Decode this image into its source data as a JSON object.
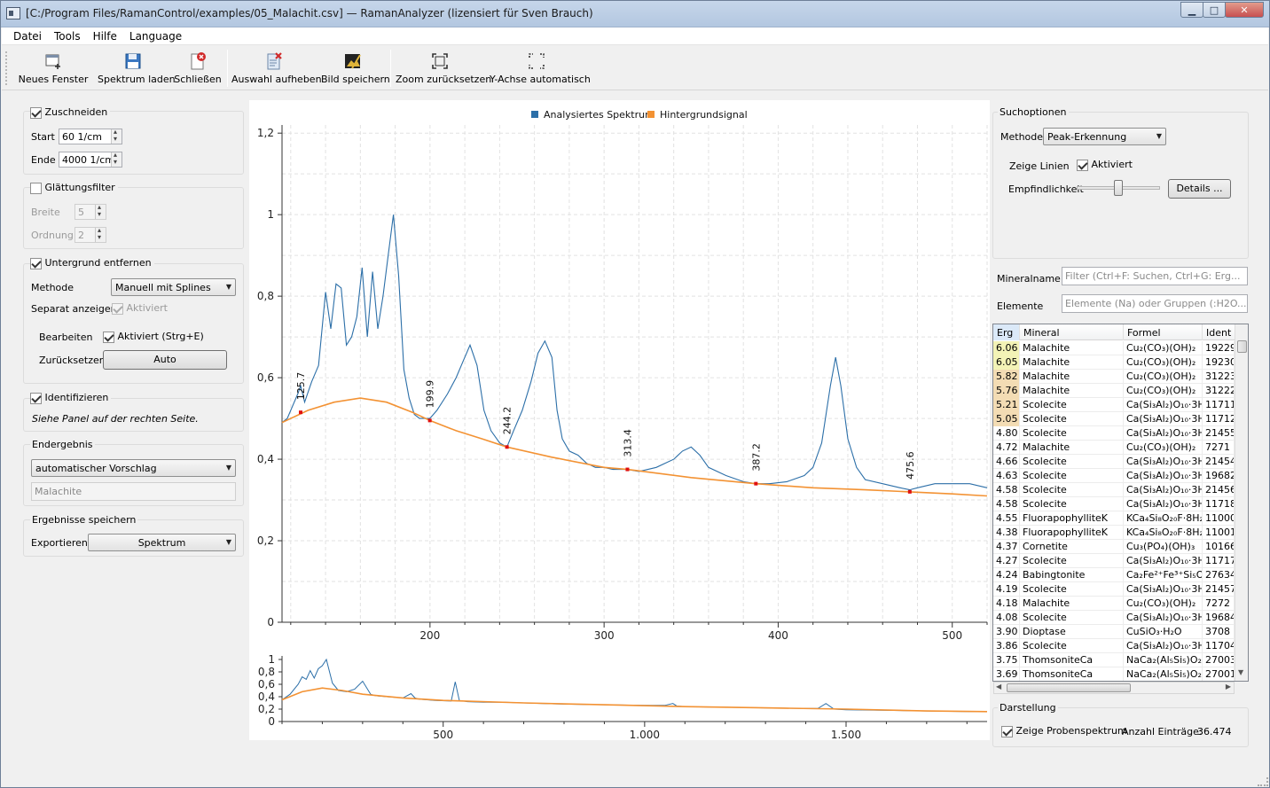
{
  "window": {
    "title": "[C:/Program Files/RamanControl/examples/05_Malachit.csv] — RamanAnalyzer (lizensiert für Sven Brauch)",
    "min_glyph": "▁",
    "max_glyph": "□",
    "close_glyph": "✕"
  },
  "menu": [
    "Datei",
    "Tools",
    "Hilfe",
    "Language"
  ],
  "toolbar": {
    "new_window": "Neues Fenster",
    "load_spectrum": "Spektrum laden",
    "close": "Schließen",
    "clear_selection": "Auswahl aufheben",
    "save_image": "Bild speichern",
    "reset_zoom": "Zoom zurücksetzen",
    "y_auto": "Y-Achse automatisch"
  },
  "left": {
    "crop": {
      "label": "Zuschneiden",
      "checked": true,
      "start_label": "Start",
      "start_value": "60 1/cm",
      "end_label": "Ende",
      "end_value": "4000 1/cm"
    },
    "smooth": {
      "label": "Glättungsfilter",
      "checked": false,
      "width_label": "Breite",
      "width_value": "5",
      "order_label": "Ordnung",
      "order_value": "2"
    },
    "background": {
      "label": "Untergrund entfernen",
      "checked": true,
      "method_label": "Methode",
      "method_value": "Manuell mit Splines",
      "separate_label": "Separat anzeigen",
      "separate_check": "Aktiviert",
      "edit_label": "Bearbeiten",
      "edit_check": "Aktiviert (Strg+E)",
      "reset_label": "Zurücksetzen",
      "reset_button": "Auto"
    },
    "identify": {
      "label": "Identifizieren",
      "checked": true,
      "hint": "Siehe Panel auf der rechten Seite."
    },
    "result": {
      "title": "Endergebnis",
      "mode": "automatischer Vorschlag",
      "value": "Malachite"
    },
    "save": {
      "title": "Ergebnisse speichern",
      "export_label": "Exportieren",
      "export_value": "Spektrum"
    }
  },
  "right": {
    "search_title": "Suchoptionen",
    "method_label": "Methode",
    "method_value": "Peak-Erkennung",
    "lines_label": "Zeige Linien",
    "lines_check": "Aktiviert",
    "sensitivity_label": "Empfindlichkeit",
    "sensitivity_level": 0.5,
    "details_button": "Details ...",
    "mineral_label": "Mineralname",
    "mineral_placeholder": "Filter (Ctrl+F: Suchen, Ctrl+G: Erg...",
    "elements_label": "Elemente",
    "elements_placeholder": "Elemente (Na) oder Gruppen (:H2O...",
    "columns": [
      "Erg",
      "Mineral",
      "Formel",
      "Ident"
    ],
    "rows": [
      {
        "score": "6.06",
        "mineral": "Malachite",
        "formula": "Cu₂(CO₃)(OH)₂",
        "ident": "19229",
        "hl": "#f3f3b6"
      },
      {
        "score": "6.05",
        "mineral": "Malachite",
        "formula": "Cu₂(CO₃)(OH)₂",
        "ident": "19230",
        "hl": "#f3f3b6"
      },
      {
        "score": "5.82",
        "mineral": "Malachite",
        "formula": "Cu₂(CO₃)(OH)₂",
        "ident": "31223",
        "hl": "#f3dcb4"
      },
      {
        "score": "5.76",
        "mineral": "Malachite",
        "formula": "Cu₂(CO₃)(OH)₂",
        "ident": "31222",
        "hl": "#f3dcb4"
      },
      {
        "score": "5.21",
        "mineral": "Scolecite",
        "formula": "Ca(Si₃Al₂)O₁₀·3H₂",
        "ident": "11711",
        "hl": "#f3dcb4"
      },
      {
        "score": "5.05",
        "mineral": "Scolecite",
        "formula": "Ca(Si₃Al₂)O₁₀·3H₂",
        "ident": "11712",
        "hl": "#f3dcb4"
      },
      {
        "score": "4.80",
        "mineral": "Scolecite",
        "formula": "Ca(Si₃Al₂)O₁₀·3H₂",
        "ident": "21455",
        "hl": ""
      },
      {
        "score": "4.72",
        "mineral": "Malachite",
        "formula": "Cu₂(CO₃)(OH)₂",
        "ident": "7271",
        "hl": ""
      },
      {
        "score": "4.66",
        "mineral": "Scolecite",
        "formula": "Ca(Si₃Al₂)O₁₀·3H₂",
        "ident": "21454",
        "hl": ""
      },
      {
        "score": "4.63",
        "mineral": "Scolecite",
        "formula": "Ca(Si₃Al₂)O₁₀·3H₂",
        "ident": "19682",
        "hl": ""
      },
      {
        "score": "4.58",
        "mineral": "Scolecite",
        "formula": "Ca(Si₃Al₂)O₁₀·3H₂",
        "ident": "21456",
        "hl": ""
      },
      {
        "score": "4.58",
        "mineral": "Scolecite",
        "formula": "Ca(Si₃Al₂)O₁₀·3H₂",
        "ident": "11718",
        "hl": ""
      },
      {
        "score": "4.55",
        "mineral": "FluorapophylliteK",
        "formula": "KCa₄Si₈O₂₀F·8H₂C",
        "ident": "11000",
        "hl": ""
      },
      {
        "score": "4.38",
        "mineral": "FluorapophylliteK",
        "formula": "KCa₄Si₈O₂₀F·8H₂C",
        "ident": "11001",
        "hl": ""
      },
      {
        "score": "4.37",
        "mineral": "Cornetite",
        "formula": "Cu₃(PO₄)(OH)₃",
        "ident": "10166",
        "hl": ""
      },
      {
        "score": "4.27",
        "mineral": "Scolecite",
        "formula": "Ca(Si₃Al₂)O₁₀·3H₂",
        "ident": "11717",
        "hl": ""
      },
      {
        "score": "4.24",
        "mineral": "Babingtonite",
        "formula": "Ca₂Fe²⁺Fe³⁺Si₅O₁",
        "ident": "27634",
        "hl": ""
      },
      {
        "score": "4.19",
        "mineral": "Scolecite",
        "formula": "Ca(Si₃Al₂)O₁₀·3H₂",
        "ident": "21457",
        "hl": ""
      },
      {
        "score": "4.18",
        "mineral": "Malachite",
        "formula": "Cu₂(CO₃)(OH)₂",
        "ident": "7272",
        "hl": ""
      },
      {
        "score": "4.08",
        "mineral": "Scolecite",
        "formula": "Ca(Si₃Al₂)O₁₀·3H₂",
        "ident": "19684",
        "hl": ""
      },
      {
        "score": "3.90",
        "mineral": "Dioptase",
        "formula": "CuSiO₃·H₂O",
        "ident": "3708",
        "hl": ""
      },
      {
        "score": "3.86",
        "mineral": "Scolecite",
        "formula": "Ca(Si₃Al₂)O₁₀·3H₂",
        "ident": "11704",
        "hl": ""
      },
      {
        "score": "3.75",
        "mineral": "ThomsoniteCa",
        "formula": "NaCa₂(Al₅Si₅)O₂₀",
        "ident": "27003",
        "hl": ""
      },
      {
        "score": "3.69",
        "mineral": "ThomsoniteCa",
        "formula": "NaCa₂(Al₅Si₅)O₂₀",
        "ident": "27001",
        "hl": ""
      }
    ],
    "display_title": "Darstellung",
    "display_check": "Zeige Probenspektrum",
    "count_label": "Anzahl Einträge:",
    "count_value": "36.474"
  },
  "chart_data": [
    {
      "type": "line",
      "legend": [
        "Analysiertes Spektrum",
        "Hintergrundsignal"
      ],
      "legend_position": "top-center",
      "colors": {
        "spectrum": "#2c6fa8",
        "background": "#f39233",
        "peak_marker": "#e01010"
      },
      "xlim": [
        115,
        520
      ],
      "ylim": [
        0,
        1.22
      ],
      "x_ticks": [
        200,
        300,
        400,
        500
      ],
      "y_ticks": [
        "0",
        "0,2",
        "0,4",
        "0,6",
        "0,8",
        "1",
        "1,2"
      ],
      "grid": true,
      "series": [
        {
          "name": "Analysiertes Spektrum",
          "x": [
            115,
            118,
            121,
            124,
            125.7,
            128,
            132,
            136,
            140,
            143,
            146,
            149,
            152,
            155,
            158,
            161,
            164,
            167,
            170,
            173,
            176,
            179,
            182,
            185,
            188,
            191,
            194,
            197,
            199.9,
            204,
            210,
            215,
            219,
            223,
            227,
            231,
            235,
            240,
            244.2,
            248,
            253,
            258,
            262,
            266,
            270,
            273,
            276,
            280,
            285,
            290,
            295,
            300,
            305,
            310,
            313.4,
            320,
            330,
            340,
            345,
            350,
            355,
            360,
            370,
            380,
            387.2,
            395,
            405,
            415,
            420,
            425,
            430,
            433,
            436,
            440,
            445,
            450,
            460,
            470,
            475.6,
            480,
            490,
            500,
            510,
            520
          ],
          "y": [
            0.49,
            0.5,
            0.53,
            0.56,
            0.58,
            0.54,
            0.59,
            0.63,
            0.81,
            0.72,
            0.83,
            0.82,
            0.68,
            0.7,
            0.75,
            0.87,
            0.7,
            0.86,
            0.72,
            0.8,
            0.9,
            1.0,
            0.85,
            0.62,
            0.55,
            0.51,
            0.5,
            0.5,
            0.5,
            0.52,
            0.56,
            0.6,
            0.64,
            0.68,
            0.63,
            0.52,
            0.47,
            0.44,
            0.43,
            0.47,
            0.52,
            0.59,
            0.66,
            0.69,
            0.65,
            0.52,
            0.45,
            0.42,
            0.41,
            0.39,
            0.38,
            0.38,
            0.375,
            0.375,
            0.375,
            0.37,
            0.38,
            0.4,
            0.42,
            0.43,
            0.41,
            0.38,
            0.36,
            0.345,
            0.34,
            0.34,
            0.345,
            0.36,
            0.38,
            0.44,
            0.58,
            0.65,
            0.58,
            0.45,
            0.38,
            0.35,
            0.34,
            0.33,
            0.325,
            0.33,
            0.34,
            0.34,
            0.34,
            0.33
          ]
        },
        {
          "name": "Hintergrundsignal",
          "x": [
            115,
            130,
            145,
            160,
            175,
            190,
            199.9,
            215,
            230,
            244.2,
            270,
            300,
            313.4,
            350,
            387.2,
            420,
            450,
            475.6,
            500,
            520
          ],
          "y": [
            0.49,
            0.52,
            0.54,
            0.55,
            0.54,
            0.515,
            0.495,
            0.47,
            0.45,
            0.43,
            0.405,
            0.38,
            0.375,
            0.355,
            0.34,
            0.33,
            0.325,
            0.32,
            0.315,
            0.31
          ]
        }
      ],
      "peaks": [
        "125.7",
        "199.9",
        "244.2",
        "313.4",
        "387.2",
        "475.6"
      ],
      "peak_x": [
        125.7,
        199.9,
        244.2,
        313.4,
        387.2,
        475.6
      ],
      "peak_y": [
        0.515,
        0.495,
        0.43,
        0.375,
        0.34,
        0.32
      ]
    },
    {
      "type": "line",
      "xlim": [
        100,
        1850
      ],
      "ylim": [
        0,
        1
      ],
      "x_ticks": [
        "500",
        "1.000",
        "1.500"
      ],
      "x_tick_values": [
        500,
        1000,
        1500
      ],
      "y_ticks": [
        "0",
        "0,2",
        "0,4",
        "0,6",
        "0,8",
        "1"
      ],
      "series": [
        {
          "name": "Analysiertes Spektrum",
          "x": [
            100,
            120,
            140,
            150,
            160,
            170,
            180,
            190,
            200,
            210,
            225,
            240,
            260,
            280,
            300,
            320,
            330,
            340,
            360,
            400,
            420,
            430,
            440,
            480,
            520,
            530,
            540,
            560,
            600,
            650,
            700,
            750,
            800,
            900,
            1000,
            1050,
            1070,
            1080,
            1100,
            1200,
            1300,
            1400,
            1430,
            1450,
            1470,
            1500,
            1600,
            1700,
            1800,
            1850
          ],
          "y": [
            0.35,
            0.44,
            0.6,
            0.72,
            0.68,
            0.82,
            0.7,
            0.85,
            0.9,
            1.0,
            0.62,
            0.5,
            0.48,
            0.52,
            0.65,
            0.44,
            0.42,
            0.41,
            0.4,
            0.38,
            0.45,
            0.38,
            0.36,
            0.34,
            0.33,
            0.64,
            0.34,
            0.32,
            0.31,
            0.31,
            0.3,
            0.29,
            0.28,
            0.27,
            0.26,
            0.26,
            0.29,
            0.25,
            0.24,
            0.23,
            0.22,
            0.21,
            0.21,
            0.29,
            0.2,
            0.19,
            0.18,
            0.17,
            0.16,
            0.16
          ]
        },
        {
          "name": "Hintergrundsignal",
          "x": [
            100,
            150,
            200,
            250,
            300,
            400,
            500,
            700,
            900,
            1100,
            1300,
            1500,
            1700,
            1850
          ],
          "y": [
            0.35,
            0.48,
            0.54,
            0.5,
            0.44,
            0.38,
            0.34,
            0.3,
            0.27,
            0.24,
            0.22,
            0.2,
            0.17,
            0.16
          ]
        }
      ]
    }
  ]
}
